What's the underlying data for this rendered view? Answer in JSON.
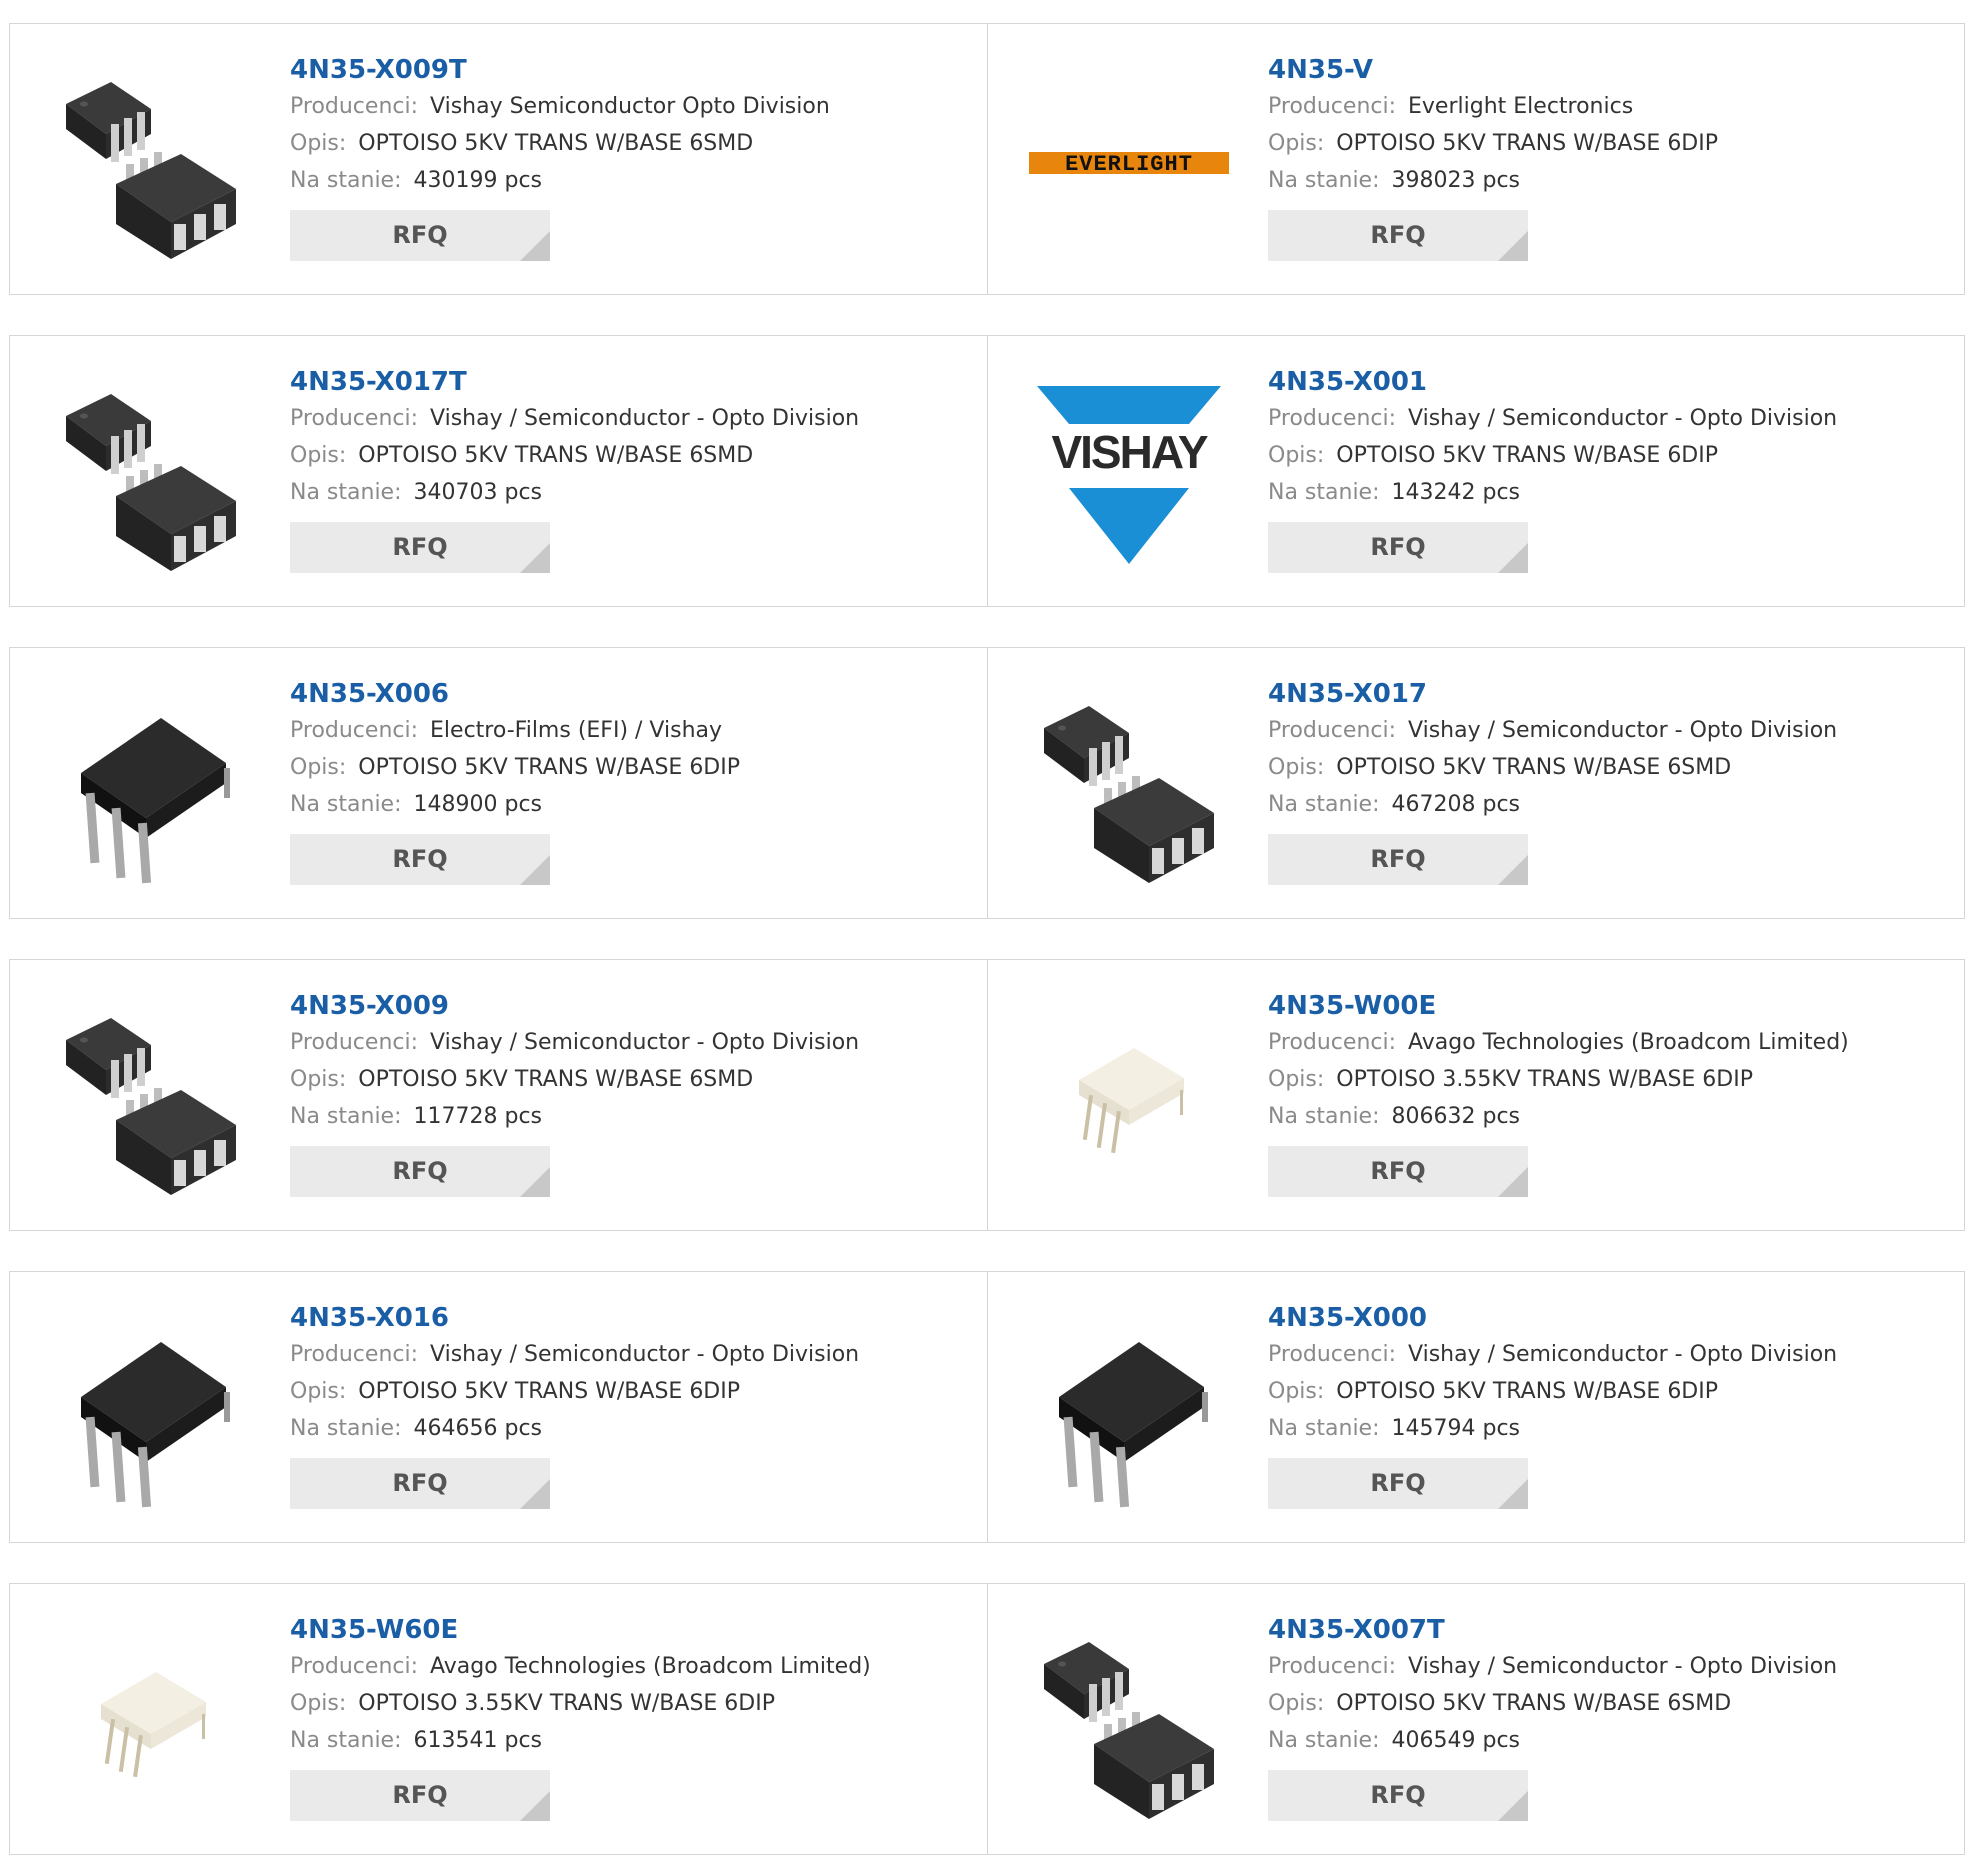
{
  "labels": {
    "manufacturer": "Producenci:",
    "description": "Opis:",
    "stock": "Na stanie:",
    "rfq": "RFQ"
  },
  "products": [
    {
      "part": "4N35-X009T",
      "manufacturer": "Vishay Semiconductor Opto Division",
      "description": "OPTOISO 5KV TRANS W/BASE 6SMD",
      "stock": "430199 pcs",
      "image": "smd-chip"
    },
    {
      "part": "4N35-V",
      "manufacturer": "Everlight Electronics",
      "description": "OPTOISO 5KV TRANS W/BASE 6DIP",
      "stock": "398023 pcs",
      "image": "everlight-logo",
      "logo_text": "EVERLIGHT"
    },
    {
      "part": "4N35-X017T",
      "manufacturer": "Vishay / Semiconductor - Opto Division",
      "description": "OPTOISO 5KV TRANS W/BASE 6SMD",
      "stock": "340703 pcs",
      "image": "smd-chip"
    },
    {
      "part": "4N35-X001",
      "manufacturer": "Vishay / Semiconductor - Opto Division",
      "description": "OPTOISO 5KV TRANS W/BASE 6DIP",
      "stock": "143242 pcs",
      "image": "vishay-logo",
      "logo_text": "VISHAY"
    },
    {
      "part": "4N35-X006",
      "manufacturer": "Electro-Films (EFI) / Vishay",
      "description": "OPTOISO 5KV TRANS W/BASE 6DIP",
      "stock": "148900 pcs",
      "image": "dip-chip-black"
    },
    {
      "part": "4N35-X017",
      "manufacturer": "Vishay / Semiconductor - Opto Division",
      "description": "OPTOISO 5KV TRANS W/BASE 6SMD",
      "stock": "467208 pcs",
      "image": "smd-chip"
    },
    {
      "part": "4N35-X009",
      "manufacturer": "Vishay / Semiconductor - Opto Division",
      "description": "OPTOISO 5KV TRANS W/BASE 6SMD",
      "stock": "117728 pcs",
      "image": "smd-chip"
    },
    {
      "part": "4N35-W00E",
      "manufacturer": "Avago Technologies (Broadcom Limited)",
      "description": "OPTOISO 3.55KV TRANS W/BASE 6DIP",
      "stock": "806632 pcs",
      "image": "dip-chip-white"
    },
    {
      "part": "4N35-X016",
      "manufacturer": "Vishay / Semiconductor - Opto Division",
      "description": "OPTOISO 5KV TRANS W/BASE 6DIP",
      "stock": "464656 pcs",
      "image": "dip-chip-black"
    },
    {
      "part": "4N35-X000",
      "manufacturer": "Vishay / Semiconductor - Opto Division",
      "description": "OPTOISO 5KV TRANS W/BASE 6DIP",
      "stock": "145794 pcs",
      "image": "dip-chip-black"
    },
    {
      "part": "4N35-W60E",
      "manufacturer": "Avago Technologies (Broadcom Limited)",
      "description": "OPTOISO 3.55KV TRANS W/BASE 6DIP",
      "stock": "613541 pcs",
      "image": "dip-chip-white"
    },
    {
      "part": "4N35-X007T",
      "manufacturer": "Vishay / Semiconductor - Opto Division",
      "description": "OPTOISO 5KV TRANS W/BASE 6SMD",
      "stock": "406549 pcs",
      "image": "smd-chip"
    }
  ],
  "colors": {
    "link": "#1a5ea6",
    "label": "#8a8a8a",
    "value": "#333333",
    "button_bg": "#eaeaea",
    "border": "#d6d6d6",
    "vishay_blue": "#1b8fd6",
    "everlight_orange": "#e8850c"
  }
}
